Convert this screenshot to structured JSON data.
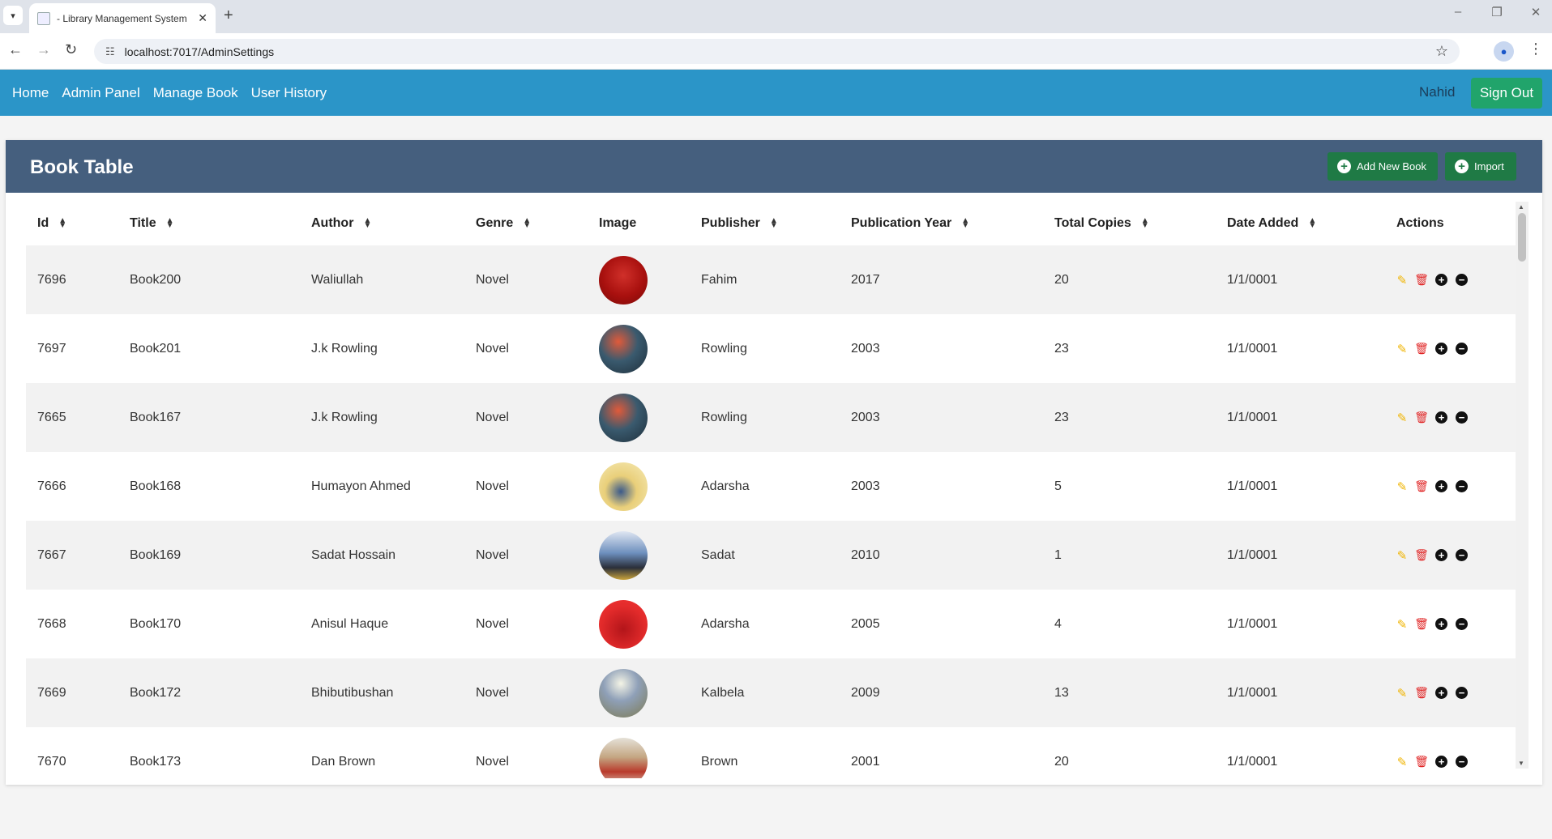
{
  "browser": {
    "tab_title": "- Library Management System",
    "tab_close": "✕",
    "new_tab": "+",
    "url": "localhost:7017/AdminSettings",
    "window_controls": [
      "–",
      "❐",
      "✕"
    ]
  },
  "navbar": {
    "links": [
      "Home",
      "Admin Panel",
      "Manage Book",
      "User History"
    ],
    "user_name": "Nahid",
    "sign_out": "Sign Out",
    "color": "#2b95c8"
  },
  "card": {
    "title": "Book Table",
    "add_button": "Add New Book",
    "import_button": "Import",
    "header_color": "#455f7e"
  },
  "table": {
    "columns": [
      "Id",
      "Title",
      "Author",
      "Genre",
      "Image",
      "Publisher",
      "Publication Year",
      "Total Copies",
      "Date Added",
      "Actions"
    ],
    "rows": [
      {
        "id": "7696",
        "title": "Book200",
        "author": "Waliullah",
        "genre": "Novel",
        "image": "red-cover",
        "publisher": "Fahim",
        "year": "2017",
        "copies": "20",
        "date": "1/1/0001"
      },
      {
        "id": "7697",
        "title": "Book201",
        "author": "J.k Rowling",
        "genre": "Novel",
        "image": "potter-cover",
        "publisher": "Rowling",
        "year": "2003",
        "copies": "23",
        "date": "1/1/0001"
      },
      {
        "id": "7665",
        "title": "Book167",
        "author": "J.k Rowling",
        "genre": "Novel",
        "image": "potter-cover",
        "publisher": "Rowling",
        "year": "2003",
        "copies": "23",
        "date": "1/1/0001"
      },
      {
        "id": "7666",
        "title": "Book168",
        "author": "Humayon Ahmed",
        "genre": "Novel",
        "image": "yellow-cover",
        "publisher": "Adarsha",
        "year": "2003",
        "copies": "5",
        "date": "1/1/0001"
      },
      {
        "id": "7667",
        "title": "Book169",
        "author": "Sadat Hossain",
        "genre": "Novel",
        "image": "storm-cover",
        "publisher": "Sadat",
        "year": "2010",
        "copies": "1",
        "date": "1/1/0001"
      },
      {
        "id": "7668",
        "title": "Book170",
        "author": "Anisul Haque",
        "genre": "Novel",
        "image": "ma-cover",
        "publisher": "Adarsha",
        "year": "2005",
        "copies": "4",
        "date": "1/1/0001"
      },
      {
        "id": "7669",
        "title": "Book172",
        "author": "Bhibutibushan",
        "genre": "Novel",
        "image": "moon-cover",
        "publisher": "Kalbela",
        "year": "2009",
        "copies": "13",
        "date": "1/1/0001"
      },
      {
        "id": "7670",
        "title": "Book173",
        "author": "Dan Brown",
        "genre": "Novel",
        "image": "angels-cover",
        "publisher": "Brown",
        "year": "2001",
        "copies": "20",
        "date": "1/1/0001"
      }
    ]
  },
  "colors": {
    "edit": "#f0b400",
    "delete": "#e02424",
    "success": "#21a46b"
  }
}
